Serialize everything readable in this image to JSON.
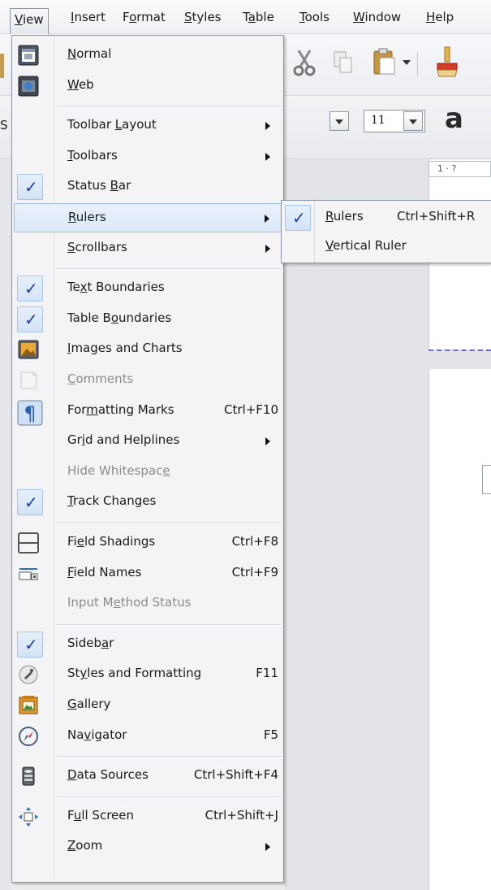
{
  "menubar": {
    "items": [
      {
        "label": "View",
        "mnemonic": "V",
        "rest": "iew",
        "name": "menu-view",
        "left": 0,
        "active": true
      },
      {
        "label": "Insert",
        "mnemonic": "I",
        "rest": "nsert",
        "name": "menu-insert"
      },
      {
        "label": "Format",
        "pre": "F",
        "mnemonic": "o",
        "rest": "rmat",
        "name": "menu-format"
      },
      {
        "label": "Styles",
        "mnemonic": "S",
        "rest": "tyles",
        "name": "menu-styles"
      },
      {
        "label": "Table",
        "pre": "T",
        "mnemonic": "a",
        "rest": "ble",
        "name": "menu-table"
      },
      {
        "label": "Tools",
        "mnemonic": "T",
        "rest": "ools",
        "name": "menu-tools"
      },
      {
        "label": "Window",
        "mnemonic": "W",
        "rest": "indow",
        "name": "menu-window"
      },
      {
        "label": "Help",
        "mnemonic": "H",
        "rest": "elp",
        "name": "menu-help"
      }
    ]
  },
  "toolbar": {
    "font_size": "11",
    "left_sliver": "S",
    "ruler_text": "1  ·  ?"
  },
  "view_menu": {
    "items": [
      {
        "type": "item",
        "pre": "",
        "mn": "N",
        "post": "ormal",
        "shortcut": "",
        "icon": "normal-view",
        "checked": false,
        "sub": false,
        "disabled": false,
        "name": "menu-item-normal"
      },
      {
        "type": "item",
        "pre": "",
        "mn": "W",
        "post": "eb",
        "shortcut": "",
        "icon": "web-view",
        "checked": false,
        "sub": false,
        "disabled": false,
        "name": "menu-item-web"
      },
      {
        "type": "sep"
      },
      {
        "type": "item",
        "pre": "Toolbar ",
        "mn": "L",
        "post": "ayout",
        "shortcut": "",
        "icon": "",
        "checked": false,
        "sub": true,
        "disabled": false,
        "name": "menu-item-toolbar-layout"
      },
      {
        "type": "item",
        "pre": "",
        "mn": "T",
        "post": "oolbars",
        "shortcut": "",
        "icon": "",
        "checked": false,
        "sub": true,
        "disabled": false,
        "name": "menu-item-toolbars"
      },
      {
        "type": "item",
        "pre": "Status ",
        "mn": "B",
        "post": "ar",
        "shortcut": "",
        "icon": "",
        "checked": true,
        "sub": false,
        "disabled": false,
        "name": "menu-item-status-bar"
      },
      {
        "type": "item",
        "pre": "",
        "mn": "R",
        "post": "ulers",
        "shortcut": "",
        "icon": "",
        "checked": false,
        "sub": true,
        "disabled": false,
        "highlight": true,
        "name": "menu-item-rulers"
      },
      {
        "type": "item",
        "pre": "",
        "mn": "S",
        "post": "crollbars",
        "shortcut": "",
        "icon": "",
        "checked": false,
        "sub": true,
        "disabled": false,
        "name": "menu-item-scrollbars"
      },
      {
        "type": "sep"
      },
      {
        "type": "item",
        "pre": "Te",
        "mn": "x",
        "post": "t Boundaries",
        "shortcut": "",
        "icon": "",
        "checked": true,
        "sub": false,
        "disabled": false,
        "name": "menu-item-text-boundaries"
      },
      {
        "type": "item",
        "pre": "Table B",
        "mn": "o",
        "post": "undaries",
        "shortcut": "",
        "icon": "",
        "checked": true,
        "sub": false,
        "disabled": false,
        "name": "menu-item-table-boundaries"
      },
      {
        "type": "item",
        "pre": "",
        "mn": "I",
        "post": "mages and Charts",
        "shortcut": "",
        "icon": "images-charts",
        "checked": false,
        "sub": false,
        "disabled": false,
        "name": "menu-item-images-and-charts"
      },
      {
        "type": "item",
        "pre": "",
        "mn": "C",
        "post": "omments",
        "shortcut": "",
        "icon": "comment",
        "checked": false,
        "sub": false,
        "disabled": true,
        "name": "menu-item-comments"
      },
      {
        "type": "item",
        "pre": "For",
        "mn": "m",
        "post": "atting Marks",
        "shortcut": "Ctrl+F10",
        "icon": "formatting-marks",
        "checked": false,
        "sub": false,
        "disabled": false,
        "name": "menu-item-formatting-marks"
      },
      {
        "type": "item",
        "pre": "Gr",
        "mn": "i",
        "post": "d and Helplines",
        "shortcut": "",
        "icon": "",
        "checked": false,
        "sub": true,
        "disabled": false,
        "name": "menu-item-grid-and-helplines"
      },
      {
        "type": "item",
        "pre": "Hide Whitespac",
        "mn": "e",
        "post": "",
        "shortcut": "",
        "icon": "",
        "checked": false,
        "sub": false,
        "disabled": true,
        "name": "menu-item-hide-whitespace"
      },
      {
        "type": "item",
        "pre": "",
        "mn": "T",
        "post": "rack Changes",
        "shortcut": "",
        "icon": "",
        "checked": true,
        "sub": false,
        "disabled": false,
        "name": "menu-item-track-changes"
      },
      {
        "type": "sep"
      },
      {
        "type": "item",
        "pre": "Fi",
        "mn": "e",
        "post": "ld Shadings",
        "shortcut": "Ctrl+F8",
        "icon": "field-shadings",
        "checked": false,
        "sub": false,
        "disabled": false,
        "name": "menu-item-field-shadings"
      },
      {
        "type": "item",
        "pre": "",
        "mn": "F",
        "post": "ield Names",
        "shortcut": "Ctrl+F9",
        "icon": "field-names",
        "checked": false,
        "sub": false,
        "disabled": false,
        "name": "menu-item-field-names"
      },
      {
        "type": "item",
        "pre": "Input M",
        "mn": "e",
        "post": "thod Status",
        "shortcut": "",
        "icon": "",
        "checked": false,
        "sub": false,
        "disabled": true,
        "name": "menu-item-input-method-status"
      },
      {
        "type": "sep"
      },
      {
        "type": "item",
        "pre": "Sideb",
        "mn": "a",
        "post": "r",
        "shortcut": "",
        "icon": "",
        "checked": true,
        "sub": false,
        "disabled": false,
        "name": "menu-item-sidebar"
      },
      {
        "type": "item",
        "pre": "St",
        "mn": "y",
        "post": "les and Formatting",
        "shortcut": "F11",
        "icon": "styles",
        "checked": false,
        "sub": false,
        "disabled": false,
        "name": "menu-item-styles-and-formatting"
      },
      {
        "type": "item",
        "pre": "",
        "mn": "G",
        "post": "allery",
        "shortcut": "",
        "icon": "gallery",
        "checked": false,
        "sub": false,
        "disabled": false,
        "name": "menu-item-gallery"
      },
      {
        "type": "item",
        "pre": "Na",
        "mn": "v",
        "post": "igator",
        "shortcut": "F5",
        "icon": "navigator",
        "checked": false,
        "sub": false,
        "disabled": false,
        "name": "menu-item-navigator"
      },
      {
        "type": "sep"
      },
      {
        "type": "item",
        "pre": "",
        "mn": "D",
        "post": "ata Sources",
        "shortcut": "Ctrl+Shift+F4",
        "icon": "data-sources",
        "checked": false,
        "sub": false,
        "disabled": false,
        "name": "menu-item-data-sources"
      },
      {
        "type": "sep"
      },
      {
        "type": "item",
        "pre": "F",
        "mn": "u",
        "post": "ll Screen",
        "shortcut": "Ctrl+Shift+J",
        "icon": "full-screen",
        "checked": false,
        "sub": false,
        "disabled": false,
        "name": "menu-item-full-screen"
      },
      {
        "type": "item",
        "pre": "",
        "mn": "Z",
        "post": "oom",
        "shortcut": "",
        "icon": "",
        "checked": false,
        "sub": true,
        "disabled": false,
        "name": "menu-item-zoom"
      }
    ]
  },
  "rulers_submenu": {
    "items": [
      {
        "pre": "",
        "mn": "R",
        "post": "ulers",
        "shortcut": "Ctrl+Shift+R",
        "checked": true,
        "name": "submenu-item-rulers"
      },
      {
        "pre": "",
        "mn": "V",
        "post": "ertical Ruler",
        "shortcut": "",
        "checked": false,
        "name": "submenu-item-vertical-ruler"
      }
    ]
  },
  "colors": {
    "highlight_border": "#9ebde6",
    "check": "#1a3ea8",
    "disabled_text": "#8b8b8b"
  }
}
